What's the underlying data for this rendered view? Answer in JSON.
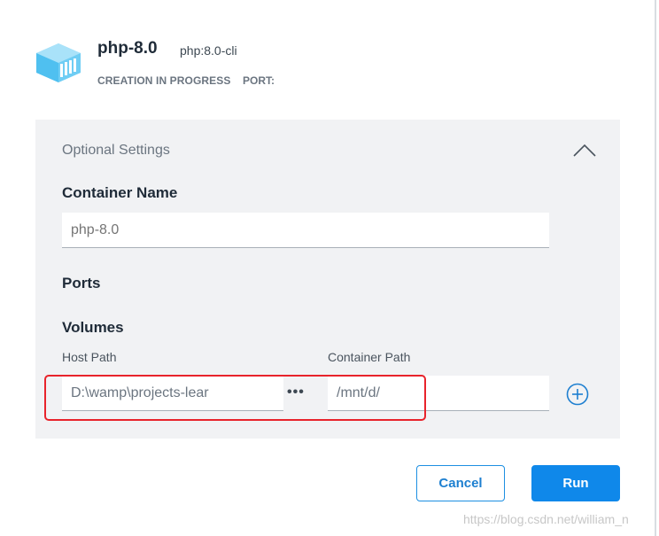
{
  "container": {
    "title": "php-8.0",
    "image": "php:8.0-cli",
    "status": "CREATION IN PROGRESS",
    "port_label": "PORT:"
  },
  "optional_settings": {
    "title": "Optional Settings",
    "expanded": true,
    "container_name": {
      "label": "Container Name",
      "placeholder": "php-8.0"
    },
    "ports": {
      "label": "Ports"
    },
    "volumes": {
      "label": "Volumes",
      "host_path_label": "Host Path",
      "container_path_label": "Container Path",
      "host_path_value": "D:\\wamp\\projects-lear",
      "container_path_value": "/mnt/d/"
    }
  },
  "actions": {
    "cancel_label": "Cancel",
    "run_label": "Run"
  },
  "watermark": "https://blog.csdn.net/william_n",
  "colors": {
    "accent": "#0f88ea",
    "panel_bg": "#f1f2f4",
    "highlight": "#e8232b",
    "logo": "#5cc6f2"
  },
  "icons": {
    "logo": "container-cube-icon",
    "collapse": "chevron-up-icon",
    "browse": "more-horizontal-icon",
    "add": "plus-circle-icon"
  }
}
